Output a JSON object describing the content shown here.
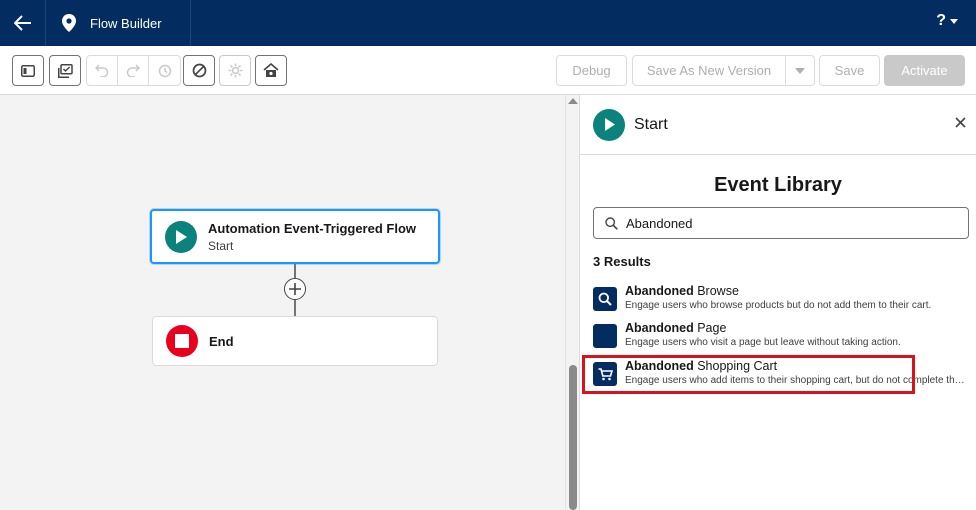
{
  "header": {
    "app_name": "Flow Builder",
    "help_label": "?"
  },
  "toolbar": {
    "debug_label": "Debug",
    "save_as_label": "Save As New Version",
    "save_label": "Save",
    "activate_label": "Activate"
  },
  "canvas": {
    "start_node": {
      "title": "Automation Event-Triggered Flow",
      "subtitle": "Start"
    },
    "end_node": {
      "title": "End"
    }
  },
  "panel": {
    "title": "Start",
    "library_title": "Event Library",
    "search": {
      "value": "Abandoned"
    },
    "results_count": "3 Results",
    "results": [
      {
        "bold": "Abandoned",
        "rest": " Browse",
        "description": "Engage users who browse products but do not add them to their cart.",
        "icon": "search-icon"
      },
      {
        "bold": "Abandoned",
        "rest": " Page",
        "description": "Engage users who visit a page but leave without taking action.",
        "icon": "page-icon"
      },
      {
        "bold": "Abandoned",
        "rest": " Shopping Cart",
        "description": "Engage users who add items to their shopping cart, but do not complete the order.",
        "icon": "cart-icon"
      }
    ]
  },
  "colors": {
    "header_bg": "#032d60",
    "start_green": "#0b827c",
    "end_red": "#ea001e",
    "selection_blue": "#1b96ff",
    "highlight_red": "#d8131b"
  }
}
